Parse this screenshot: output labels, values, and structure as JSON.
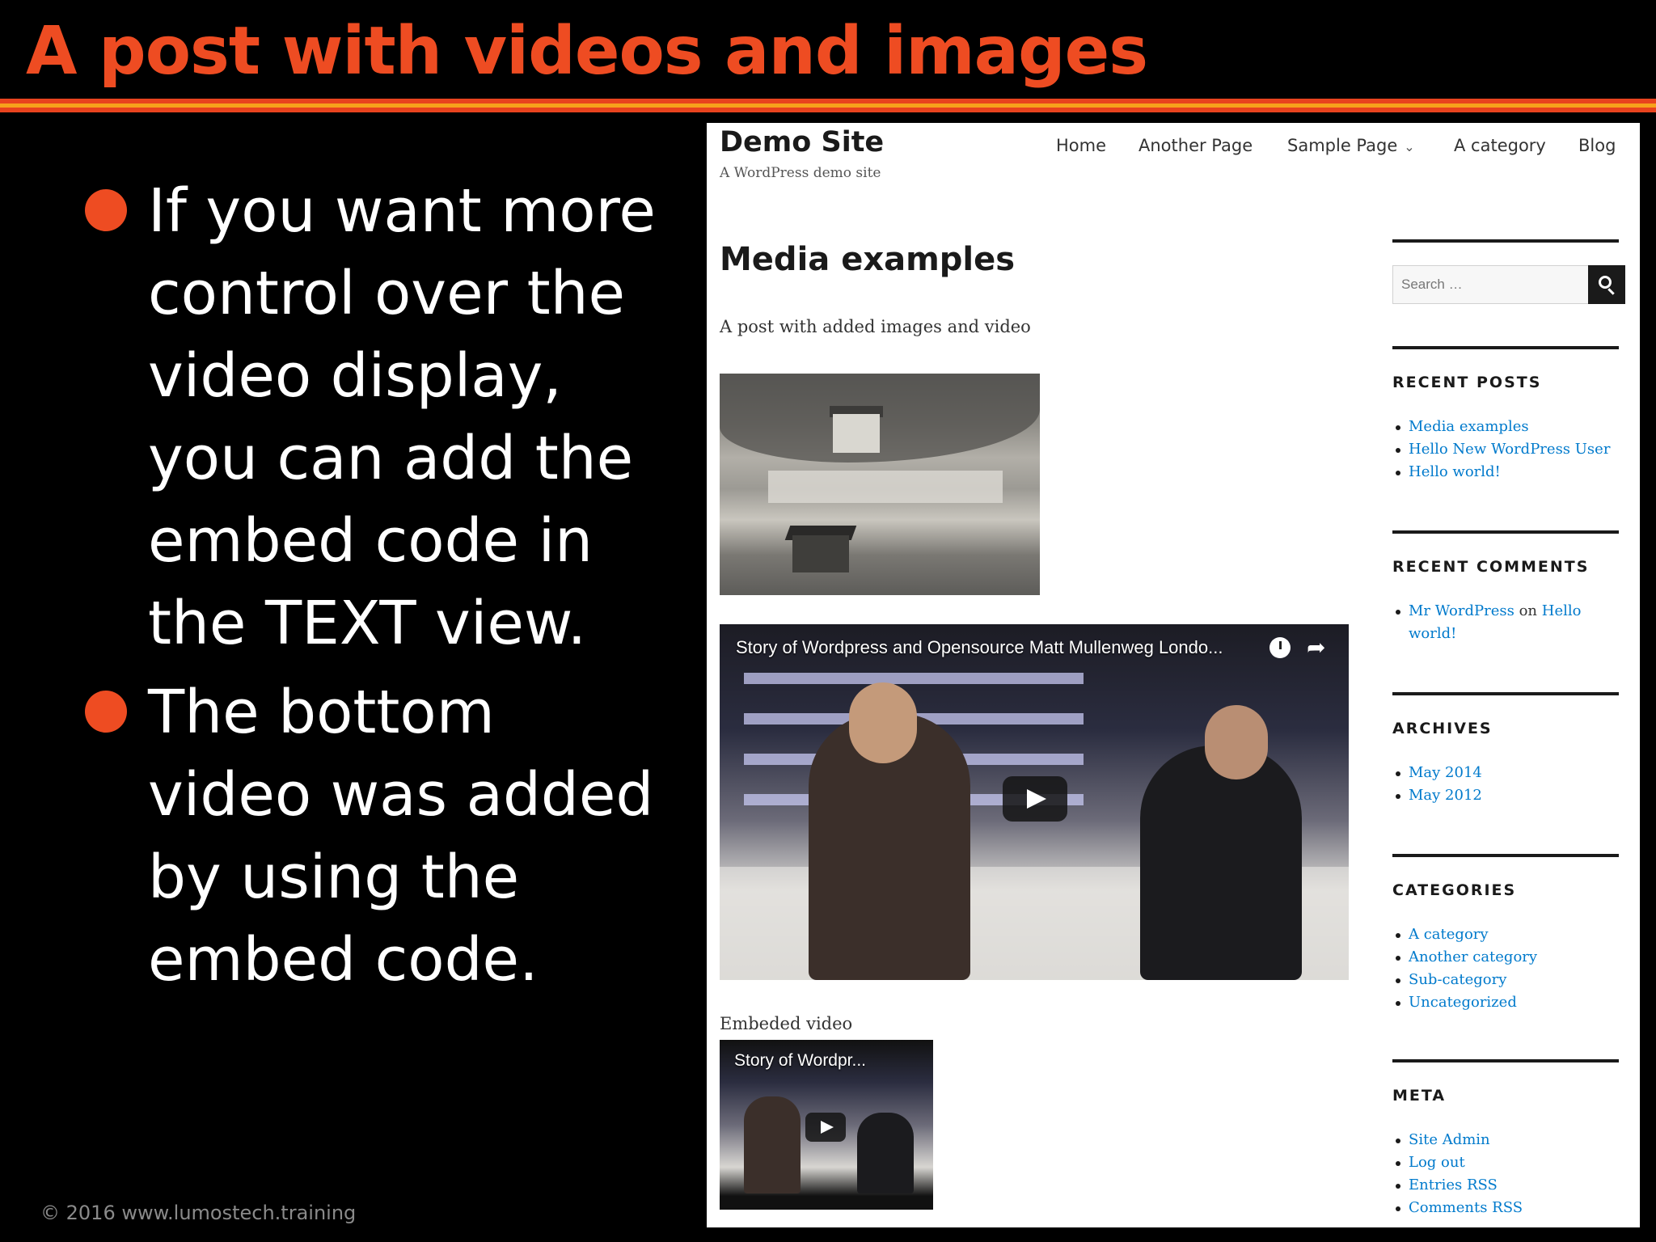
{
  "slide": {
    "title": "A post with videos and images",
    "bullets": [
      [
        "If you want more",
        "control over the",
        "video display,",
        "you can add the",
        "embed code in",
        "the TEXT view."
      ],
      [
        "The bottom",
        "video was added",
        "by using the",
        "embed code."
      ]
    ],
    "footer": "© 2016  www.lumostech.training",
    "accent_color": "#ee4c22",
    "stripe_color": "#f6a21b"
  },
  "site": {
    "title": "Demo Site",
    "tagline": "A WordPress demo site",
    "nav": {
      "home": "Home",
      "another_page": "Another Page",
      "sample_page": "Sample Page",
      "sample_page_icon": "chevron-down-icon",
      "a_category": "A category",
      "blog": "Blog"
    },
    "post": {
      "title": "Media examples",
      "intro": "A post with added images and video",
      "video_caption": "Story of Wordpress and Opensource Matt Mullenweg Londo...",
      "embed_label": "Embeded video",
      "small_video_caption": "Story of Wordpr..."
    },
    "sidebar": {
      "search_placeholder": "Search …",
      "recent_posts": {
        "title": "RECENT POSTS",
        "items": [
          "Media examples",
          "Hello New WordPress User",
          "Hello world!"
        ]
      },
      "recent_comments": {
        "title": "RECENT COMMENTS",
        "author": "Mr WordPress",
        "connector": "on",
        "post": "Hello world!"
      },
      "archives": {
        "title": "ARCHIVES",
        "items": [
          "May 2014",
          "May 2012"
        ]
      },
      "categories": {
        "title": "CATEGORIES",
        "items": [
          "A category",
          "Another category",
          "Sub-category",
          "Uncategorized"
        ]
      },
      "meta": {
        "title": "META",
        "items": [
          "Site Admin",
          "Log out",
          "Entries RSS",
          "Comments RSS"
        ]
      }
    },
    "link_color": "#007acc"
  }
}
